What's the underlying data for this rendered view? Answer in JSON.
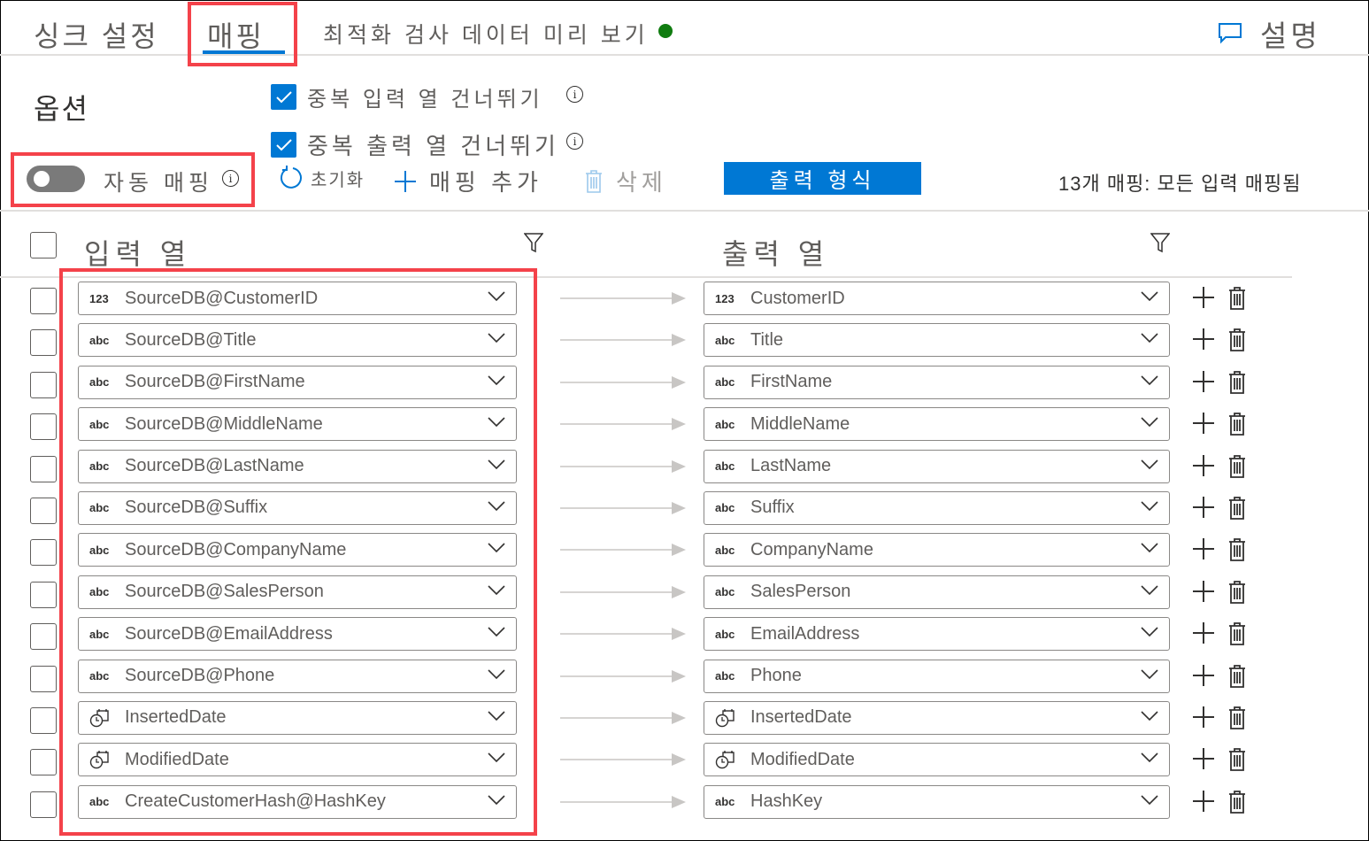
{
  "tabs": [
    {
      "label": "싱크 설정",
      "active": false
    },
    {
      "label": "매핑",
      "active": true
    },
    {
      "label": "최적화 검사 데이터 미리 보기",
      "active": false
    }
  ],
  "status": {
    "color": "#107c10",
    "state": "ok"
  },
  "help": {
    "icon": "comment-icon",
    "label": "설명"
  },
  "options": {
    "title": "옵션",
    "skip_duplicate_inputs": {
      "label": "중복 입력 열 건너뛰기",
      "checked": true
    },
    "skip_duplicate_outputs": {
      "label": "중복 출력 열 건너뛰기",
      "checked": true
    }
  },
  "toolbar": {
    "auto_mapping": {
      "label": "자동 매핑",
      "on": false
    },
    "reset_label": "초기화",
    "add_mapping_label": "매핑 추가",
    "delete_label": "삭제",
    "output_format_label": "출력 형식",
    "summary": "13개 매핑: 모든 입력 매핑됨"
  },
  "table": {
    "input_header": "입력 열",
    "output_header": "출력 열",
    "rows": [
      {
        "type": "123",
        "input": "SourceDB@CustomerID",
        "output": "CustomerID"
      },
      {
        "type": "abc",
        "input": "SourceDB@Title",
        "output": "Title"
      },
      {
        "type": "abc",
        "input": "SourceDB@FirstName",
        "output": "FirstName"
      },
      {
        "type": "abc",
        "input": "SourceDB@MiddleName",
        "output": "MiddleName"
      },
      {
        "type": "abc",
        "input": "SourceDB@LastName",
        "output": "LastName"
      },
      {
        "type": "abc",
        "input": "SourceDB@Suffix",
        "output": "Suffix"
      },
      {
        "type": "abc",
        "input": "SourceDB@CompanyName",
        "output": "CompanyName"
      },
      {
        "type": "abc",
        "input": "SourceDB@SalesPerson",
        "output": "SalesPerson"
      },
      {
        "type": "abc",
        "input": "SourceDB@EmailAddress",
        "output": "EmailAddress"
      },
      {
        "type": "abc",
        "input": "SourceDB@Phone",
        "output": "Phone"
      },
      {
        "type": "datetime",
        "input": "InsertedDate",
        "output": "InsertedDate"
      },
      {
        "type": "datetime",
        "input": "ModifiedDate",
        "output": "ModifiedDate"
      },
      {
        "type": "abc",
        "input": "CreateCustomerHash@HashKey",
        "output": "HashKey"
      }
    ]
  },
  "colors": {
    "accent": "#0078d4",
    "highlight": "#f4424a",
    "muted": "#a19f9d"
  }
}
